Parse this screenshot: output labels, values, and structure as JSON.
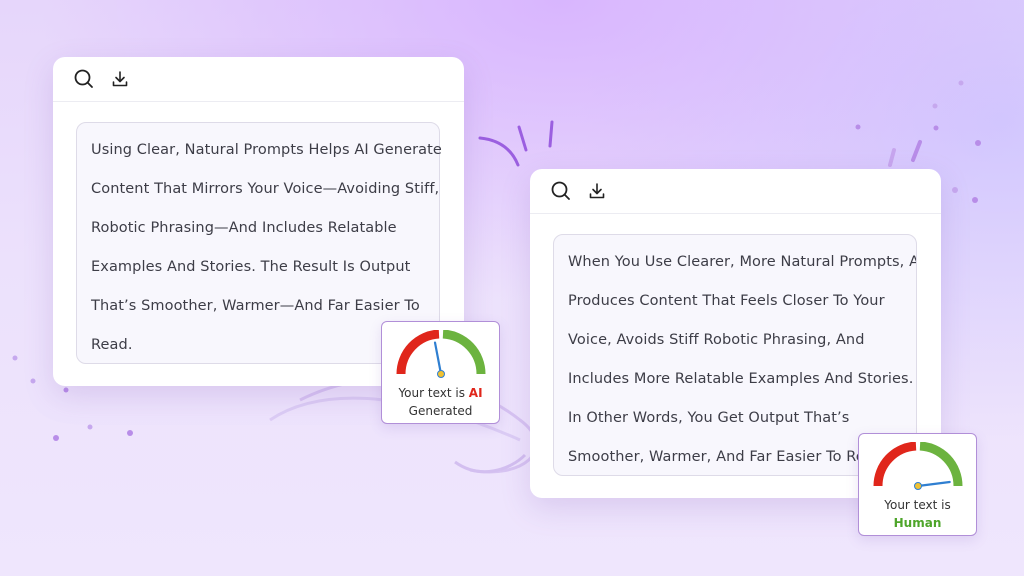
{
  "colors": {
    "accent_red": "#e0261b",
    "accent_green": "#6cb33f",
    "needle": "#2f7fd1",
    "border_purple": "#b18fd8"
  },
  "card_left": {
    "icons": [
      "search-icon",
      "download-icon"
    ],
    "lines": [
      "Using Clear, Natural Prompts Helps AI Generate",
      "Content That Mirrors Your Voice—Avoiding Stiff,",
      "Robotic Phrasing—And Includes Relatable",
      "Examples And Stories. The Result Is Output",
      "That’s Smoother, Warmer—And Far Easier To",
      "Read."
    ]
  },
  "card_right": {
    "icons": [
      "search-icon",
      "download-icon"
    ],
    "lines": [
      "When You Use Clearer, More Natural Prompts, AI",
      "Produces Content That Feels Closer To Your",
      "Voice, Avoids Stiff Robotic Phrasing, And",
      "Includes More Relatable Examples And Stories.",
      "In Other Words, You Get Output That’s",
      "Smoother, Warmer, And Far Easier To Read."
    ]
  },
  "gauge_ai": {
    "prefix": "Your text is",
    "verdict": "AI",
    "suffix": "Generated",
    "level": 0.44
  },
  "gauge_human": {
    "prefix": "Your text is",
    "verdict": "Human",
    "level": 0.96
  }
}
